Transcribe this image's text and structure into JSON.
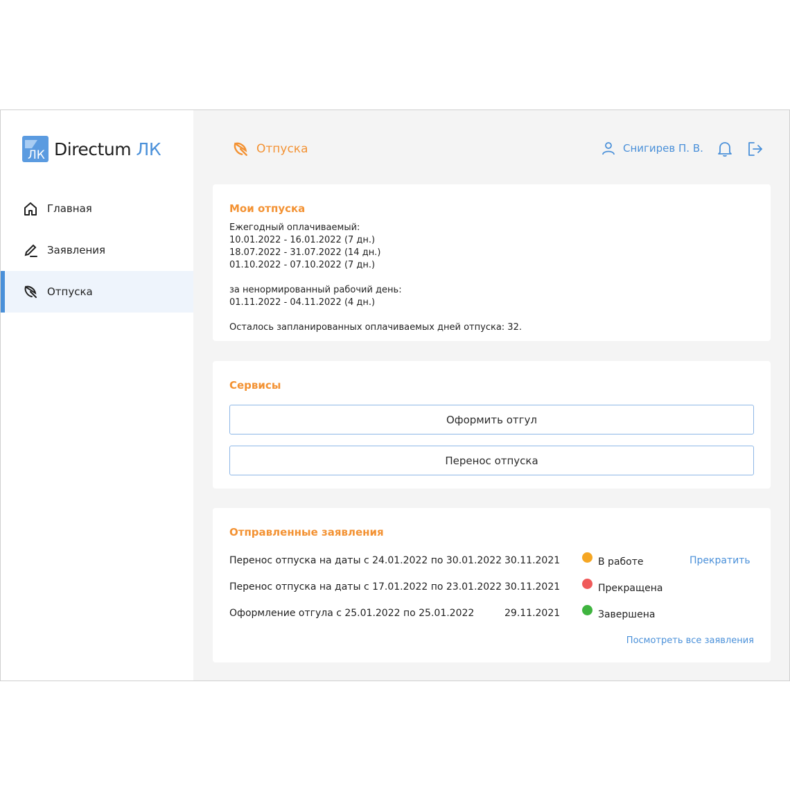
{
  "app": {
    "logo_text": "Directum",
    "logo_accent": "ЛК",
    "logo_mark_text": "ЛК",
    "accent_color": "#4a90d9",
    "title_color": "#f39233"
  },
  "sidebar": {
    "items": [
      {
        "label": "Главная",
        "icon": "home-icon"
      },
      {
        "label": "Заявления",
        "icon": "pen-icon"
      },
      {
        "label": "Отпуска",
        "icon": "umbrella-icon",
        "active": true
      }
    ]
  },
  "header": {
    "title": "Отпуска",
    "user_name": "Снигирев П. В."
  },
  "my_vacations": {
    "title": "Мои отпуска",
    "lines": [
      "Ежегодный оплачиваемый:",
      "10.01.2022 - 16.01.2022 (7 дн.)",
      "18.07.2022 - 31.07.2022 (14 дн.)",
      "01.10.2022 - 07.10.2022 (7 дн.)",
      "",
      "за ненормированный рабочий день:",
      "01.11.2022 - 04.11.2022 (4 дн.)",
      "",
      "Осталось запланированных оплачиваемых дней отпуска: 32."
    ]
  },
  "services": {
    "title": "Сервисы",
    "buttons": [
      "Оформить отгул",
      "Перенос отпуска"
    ]
  },
  "requests": {
    "title": "Отправленные заявления",
    "rows": [
      {
        "title": "Перенос отпуска на даты с 24.01.2022 по 30.01.2022",
        "date": "30.11.2021",
        "status": "В работе",
        "status_color": "#f5a623",
        "action": "Прекратить"
      },
      {
        "title": "Перенос отпуска на даты с 17.01.2022 по 23.01.2022",
        "date": "30.11.2021",
        "status": "Прекращена",
        "status_color": "#f05a5a",
        "action": ""
      },
      {
        "title": "Оформление отгула с 25.01.2022 по 25.01.2022",
        "date": "29.11.2021",
        "status": "Завершена",
        "status_color": "#3fb43f",
        "action": ""
      }
    ],
    "view_all": "Посмотреть все заявления"
  }
}
